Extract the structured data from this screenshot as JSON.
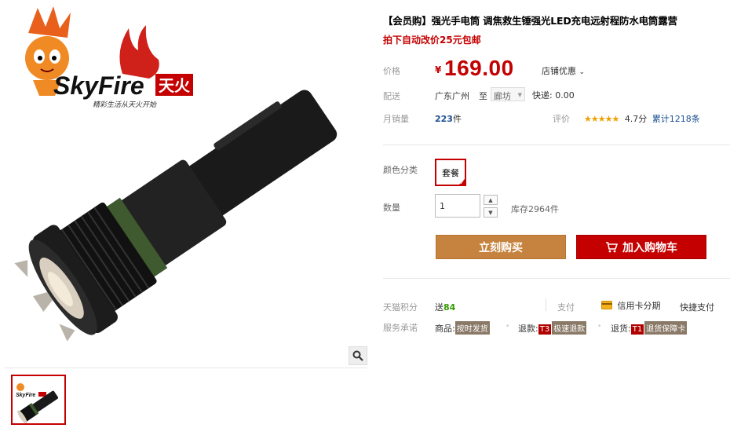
{
  "gallery": {
    "logo_brand": "SkyFire",
    "logo_cn": "天火",
    "logo_slogan": "精彩生活从天火开始",
    "zoom_icon": "search-icon"
  },
  "product": {
    "title": "【会员购】强光手电筒 调焦救生锤强光LED充电远射程防水电筒露营",
    "subtitle": "拍下自动改价25元包邮"
  },
  "price": {
    "label": "价格",
    "currency": "¥",
    "value": "169.00",
    "promo": "店铺优惠"
  },
  "shipping": {
    "label": "配送",
    "from": "广东广州",
    "to_word": "至",
    "dest": "廊坊",
    "express": "快递: 0.00"
  },
  "sales": {
    "label": "月销量",
    "count": "223",
    "unit": "件"
  },
  "rating": {
    "label": "评价",
    "stars": "★★★★★",
    "score": "4.7分",
    "total": "累计1218条"
  },
  "sku": {
    "label": "颜色分类",
    "option": "套餐"
  },
  "quantity": {
    "label": "数量",
    "value": "1",
    "stock": "库存2964件"
  },
  "buttons": {
    "buy": "立刻购买",
    "cart": "加入购物车"
  },
  "points": {
    "label": "天猫积分",
    "prefix": "送",
    "value": "84"
  },
  "payment": {
    "label": "支付",
    "credit": "信用卡分期",
    "quick": "快捷支付"
  },
  "services": {
    "label": "服务承诺",
    "s1_prefix": "商品:",
    "s1_tag": "按时发货",
    "s2_prefix": "退款:",
    "s2_code": "T3",
    "s2_tag": "极速退款",
    "s3_prefix": "退货:",
    "s3_code": "T1",
    "s3_tag": "退货保障卡"
  },
  "colors": {
    "accent": "#c40000",
    "buy_button": "#c6833f",
    "star": "#f0a000",
    "points_green": "#339900"
  }
}
